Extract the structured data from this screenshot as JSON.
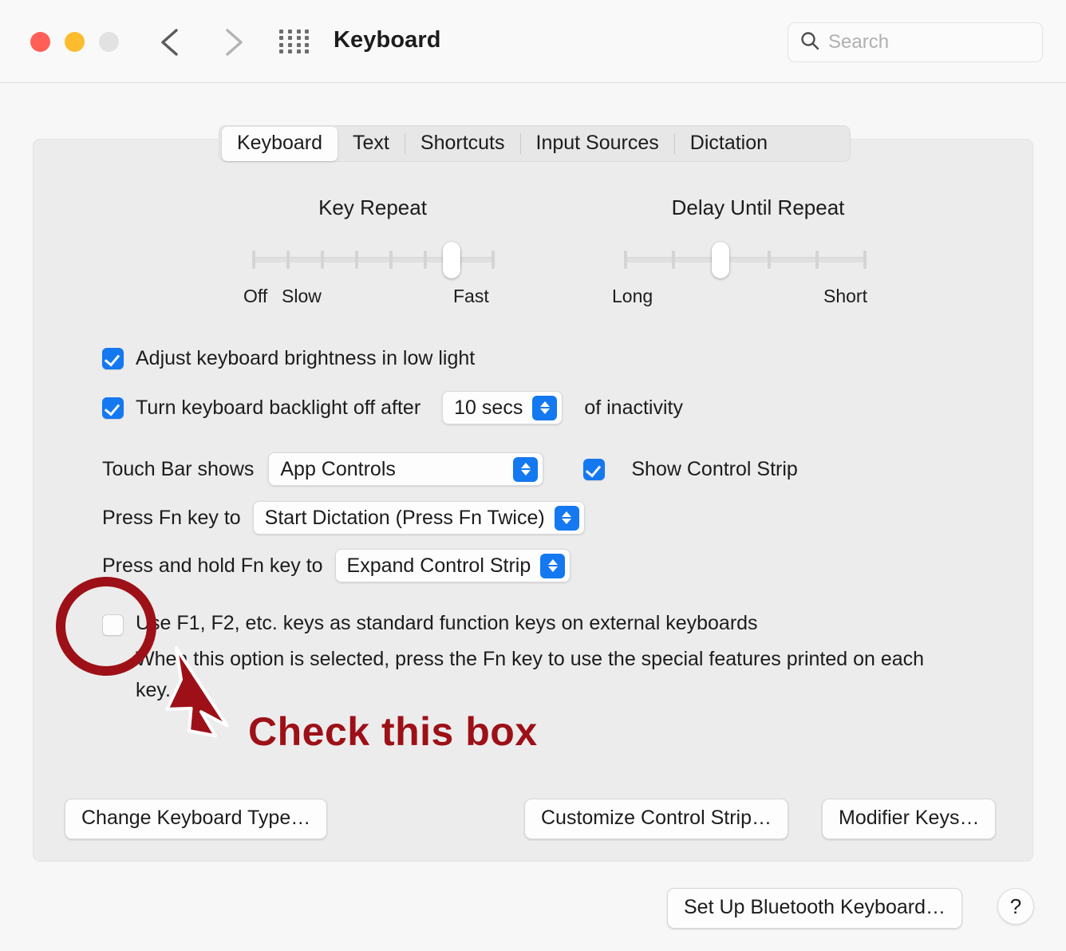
{
  "window": {
    "title": "Keyboard",
    "traffic_lights": [
      "close",
      "minimize",
      "zoom"
    ],
    "back_icon": "chevron-left-icon",
    "forward_icon": "chevron-right-icon",
    "grid_icon": "show-all-grid-icon"
  },
  "search": {
    "placeholder": "Search",
    "value": "",
    "icon": "search-icon"
  },
  "tabs": [
    {
      "label": "Keyboard",
      "active": true
    },
    {
      "label": "Text",
      "active": false
    },
    {
      "label": "Shortcuts",
      "active": false
    },
    {
      "label": "Input Sources",
      "active": false
    },
    {
      "label": "Dictation",
      "active": false
    }
  ],
  "sliders": {
    "key_repeat": {
      "title": "Key Repeat",
      "ticks": 8,
      "value_index": 7,
      "labels": {
        "off": "Off",
        "slow": "Slow",
        "fast": "Fast"
      }
    },
    "delay_until_repeat": {
      "title": "Delay Until Repeat",
      "ticks": 6,
      "value_index": 3,
      "labels": {
        "long": "Long",
        "short": "Short"
      }
    }
  },
  "options": {
    "adjust_brightness": {
      "label": "Adjust keyboard brightness in low light",
      "checked": true
    },
    "backlight_off": {
      "label_before": "Turn keyboard backlight off after",
      "value": "10 secs",
      "label_after": "of inactivity",
      "checked": true
    },
    "touch_bar_shows": {
      "label": "Touch Bar shows",
      "value": "App Controls"
    },
    "show_control_strip": {
      "label": "Show Control Strip",
      "checked": true
    },
    "press_fn": {
      "label": "Press Fn key to",
      "value": "Start Dictation (Press Fn Twice)"
    },
    "press_hold_fn": {
      "label": "Press and hold Fn key to",
      "value": "Expand Control Strip"
    },
    "function_keys": {
      "label": "Use F1, F2, etc. keys as standard function keys on external keyboards",
      "description": "When this option is selected, press the Fn key to use the special features printed on each key.",
      "checked": false
    }
  },
  "buttons": {
    "change_keyboard_type": "Change Keyboard Type…",
    "customize_control_strip": "Customize Control Strip…",
    "modifier_keys": "Modifier Keys…",
    "set_up_bluetooth": "Set Up Bluetooth Keyboard…",
    "help": "?"
  },
  "annotation": {
    "text": "Check this box",
    "color": "#9d1017",
    "circle_icon": "highlight-ellipse-icon",
    "arrow_icon": "pointer-arrow-icon"
  },
  "colors": {
    "accent_blue": "#1478f0",
    "window_bg": "#f7f7f7",
    "panel_bg": "#ececec",
    "annotation_red": "#9d1017"
  }
}
